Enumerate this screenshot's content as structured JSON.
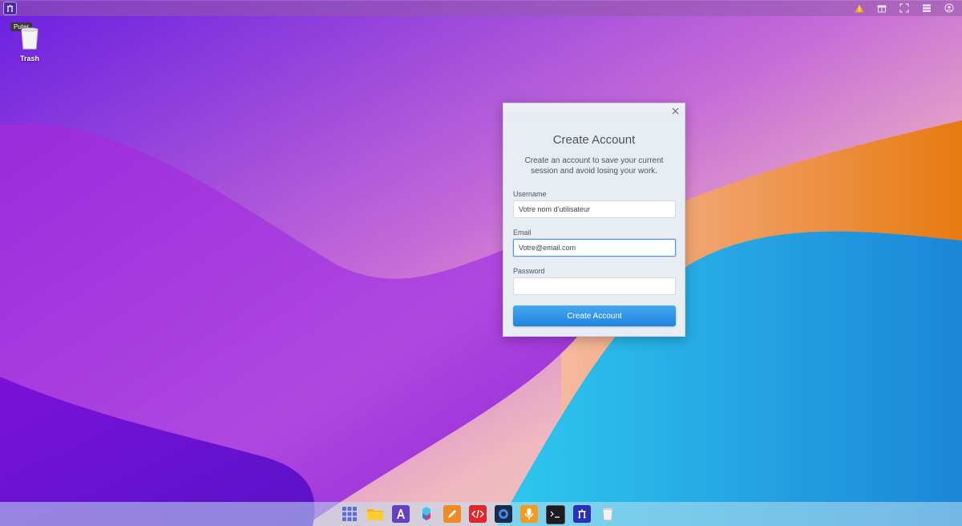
{
  "topbar": {
    "logo_icon": "puter-logo-icon",
    "tray_icons": [
      "warning-icon",
      "gift-icon",
      "fullscreen-icon",
      "grid-list-icon",
      "user-icon"
    ],
    "warning_color": "#f5b000"
  },
  "tooltip": {
    "text": "Puter"
  },
  "desktop": {
    "trash": {
      "label": "Trash",
      "icon": "trash-icon"
    }
  },
  "dialog": {
    "title": "Create Account",
    "description": "Create an account to save your current session and avoid losing your work.",
    "username": {
      "label": "Username",
      "value": "Votre nom d’utilisateur"
    },
    "email": {
      "label": "Email",
      "value": "Votre@email.com"
    },
    "password": {
      "label": "Password",
      "value": ""
    },
    "submit_label": "Create Account",
    "accent": "#2a8fe6"
  },
  "taskbar": {
    "apps": [
      "app-launcher-icon",
      "files-icon",
      "editor-icon",
      "dev-center-icon",
      "draw-icon",
      "code-icon",
      "camera-icon",
      "recorder-icon",
      "terminal-icon",
      "puter-icon",
      "trash-icon"
    ]
  }
}
